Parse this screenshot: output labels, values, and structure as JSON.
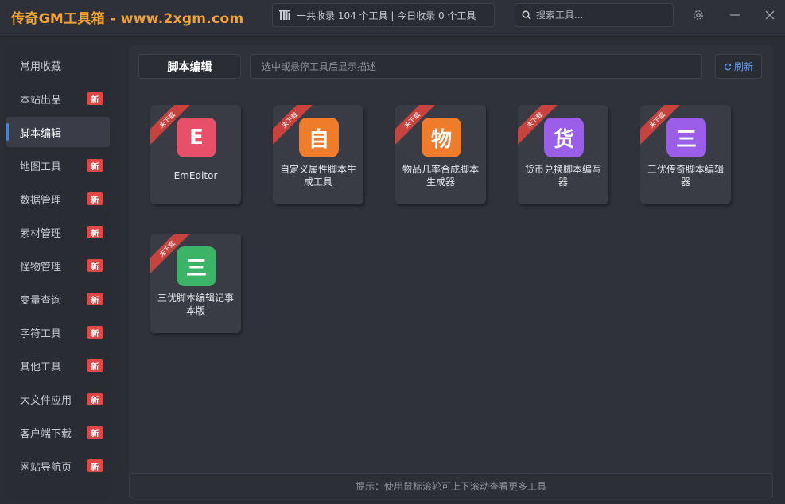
{
  "app": {
    "title": "传奇GM工具箱 - www.2xgm.com",
    "stats": "一共收录 104 个工具 | 今日收录 0 个工具",
    "search_placeholder": "搜索工具...",
    "settings_icon": "gear-icon",
    "minimize_icon": "minimize-icon",
    "close_icon": "close-icon",
    "accent_color": "#f0a234"
  },
  "sidebar": {
    "active_index": 2,
    "badge_color": "#e04848",
    "items": [
      {
        "label": "常用收藏",
        "badge": ""
      },
      {
        "label": "本站出品",
        "badge": "新"
      },
      {
        "label": "脚本编辑",
        "badge": ""
      },
      {
        "label": "地图工具",
        "badge": "新"
      },
      {
        "label": "数据管理",
        "badge": "新"
      },
      {
        "label": "素材管理",
        "badge": "新"
      },
      {
        "label": "怪物管理",
        "badge": "新"
      },
      {
        "label": "变量查询",
        "badge": "新"
      },
      {
        "label": "字符工具",
        "badge": "新"
      },
      {
        "label": "其他工具",
        "badge": "新"
      },
      {
        "label": "大文件应用",
        "badge": "新"
      },
      {
        "label": "客户端下载",
        "badge": "新"
      },
      {
        "label": "网站导航页",
        "badge": "新"
      }
    ]
  },
  "main": {
    "section_title": "脚本编辑",
    "description_placeholder": "选中或悬停工具后显示描述",
    "refresh_label": "刷新",
    "hint": "提示：使用鼠标滚轮可上下滚动查看更多工具",
    "tools": [
      {
        "icon_char": "E",
        "name": "EmEditor",
        "ribbon": "未下载",
        "color": "#e8506a"
      },
      {
        "icon_char": "自",
        "name": "自定义属性脚本生成工具",
        "ribbon": "未下载",
        "color": "#ef7c2a"
      },
      {
        "icon_char": "物",
        "name": "物品几率合成脚本生成器",
        "ribbon": "未下载",
        "color": "#ef7c2a"
      },
      {
        "icon_char": "货",
        "name": "货币兑换脚本编写器",
        "ribbon": "未下载",
        "color": "#9a5ee8"
      },
      {
        "icon_char": "三",
        "name": "三优传奇脚本编辑器",
        "ribbon": "未下载",
        "color": "#9a5ee8"
      },
      {
        "icon_char": "三",
        "name": "三优脚本编辑记事本版",
        "ribbon": "未下载",
        "color": "#3cb468"
      }
    ]
  }
}
